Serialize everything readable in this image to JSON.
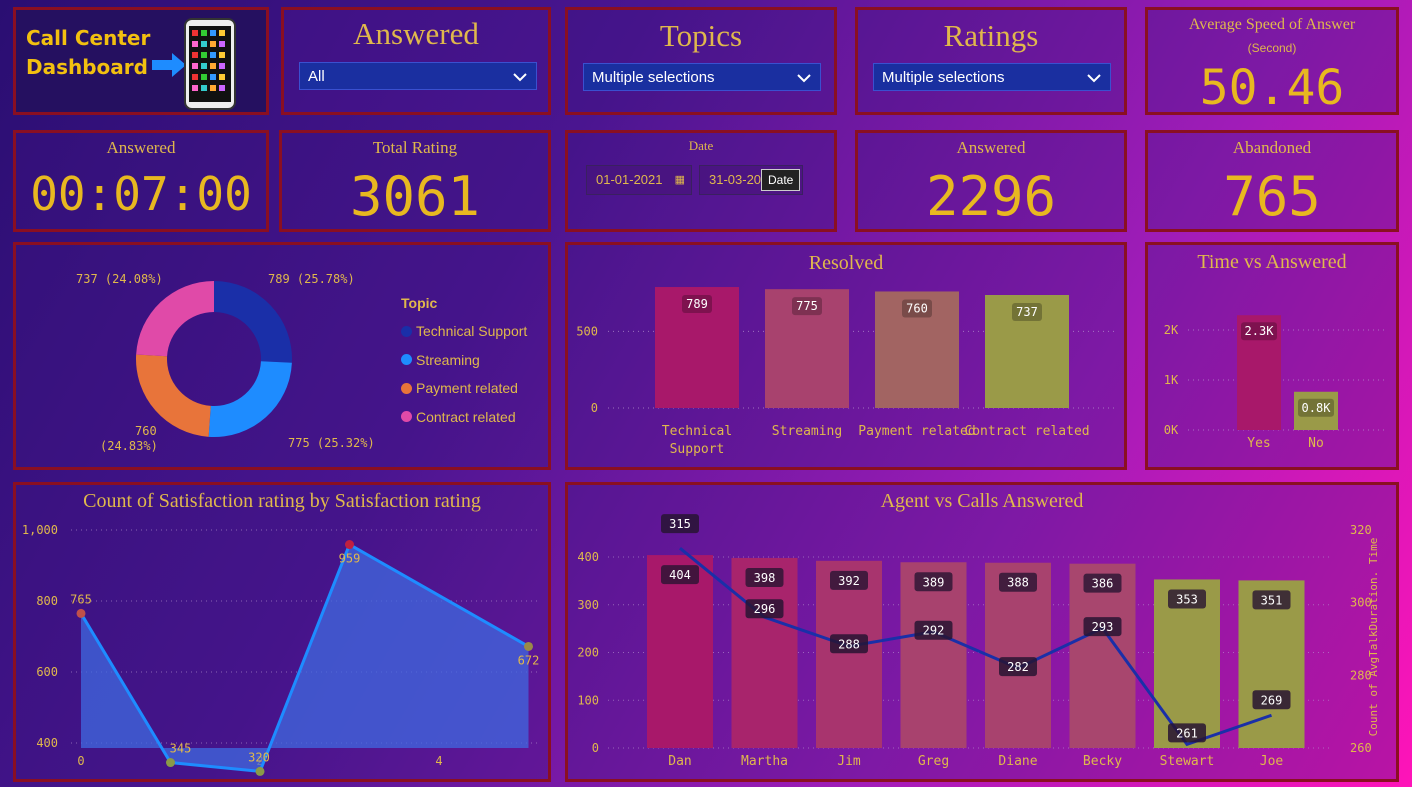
{
  "header": {
    "logo_line1": "Call Center",
    "logo_line2": "Dashboard",
    "logo_icon": "phone-icon"
  },
  "slicers": {
    "answered": {
      "title": "Answered",
      "value": "All"
    },
    "topics": {
      "title": "Topics",
      "value": "Multiple selections"
    },
    "ratings": {
      "title": "Ratings",
      "value": "Multiple selections"
    }
  },
  "speed": {
    "title": "Average Speed of Answer",
    "subtitle": "(Second)",
    "value": "50.46"
  },
  "kpis": {
    "answered_time": {
      "title": "Answered",
      "value": "00:07:00"
    },
    "total_rating": {
      "title": "Total Rating",
      "value": "3061"
    },
    "answered_count": {
      "title": "Answered",
      "value": "2296"
    },
    "abandoned": {
      "title": "Abandoned",
      "value": "765"
    }
  },
  "date_slicer": {
    "title": "Date",
    "start": "01-01-2021",
    "end": "31-03-20",
    "tooltip": "Date"
  },
  "donut": {
    "legend_title": "Topic",
    "items": [
      {
        "label": "Technical Support",
        "value": 789,
        "pct": "789 (25.78%)",
        "color": "#1a2fa8"
      },
      {
        "label": "Streaming",
        "value": 775,
        "pct": "775 (25.32%)",
        "color": "#1e8cff"
      },
      {
        "label": "Payment related",
        "value": 760,
        "pct_a": "760",
        "pct_b": "(24.83%)",
        "color": "#e8743a"
      },
      {
        "label": "Contract related",
        "value": 737,
        "pct": "737 (24.08%)",
        "color": "#e04aa8"
      }
    ]
  },
  "chart_data": [
    {
      "type": "bar",
      "title": "Resolved",
      "categories": [
        "Technical Support",
        "Streaming",
        "Payment related",
        "Contract related"
      ],
      "values": [
        789,
        775,
        760,
        737
      ],
      "colors": [
        "#a8186a",
        "#a8426e",
        "#a26462",
        "#9a9a48"
      ],
      "yticks": [
        "0",
        "500"
      ],
      "ylim": [
        0,
        900
      ]
    },
    {
      "type": "bar",
      "title": "Time vs Answered",
      "categories": [
        "Yes",
        "No"
      ],
      "values": [
        2296,
        765
      ],
      "labels": [
        "2.3K",
        "0.8K"
      ],
      "yticks": [
        "0K",
        "1K",
        "2K"
      ],
      "ylim": [
        0,
        2500
      ]
    },
    {
      "type": "area",
      "title": "Count of Satisfaction rating by Satisfaction rating",
      "x": [
        0,
        1,
        2,
        3,
        5
      ],
      "values": [
        765,
        345,
        320,
        959,
        672
      ],
      "xticks": [
        "0",
        "2",
        "4"
      ],
      "yticks": [
        "400",
        "600",
        "800",
        "1,000"
      ],
      "ylim": [
        300,
        1000
      ]
    },
    {
      "type": "bar+line",
      "title": "Agent vs Calls Answered",
      "categories": [
        "Dan",
        "Martha",
        "Jim",
        "Greg",
        "Diane",
        "Becky",
        "Stewart",
        "Joe"
      ],
      "series": [
        {
          "values": [
            404,
            398,
            392,
            389,
            388,
            386,
            353,
            351
          ]
        },
        {
          "name": "Count of AvgTalkDuration. Time",
          "values": [
            315,
            296,
            288,
            292,
            282,
            293,
            261,
            269
          ]
        }
      ],
      "yticks_left": [
        "0",
        "100",
        "200",
        "300",
        "400"
      ],
      "yticks_right": [
        "260",
        "280",
        "300",
        "320"
      ],
      "ylabel_right": "Count of AvgTalkDuration. Time"
    }
  ]
}
